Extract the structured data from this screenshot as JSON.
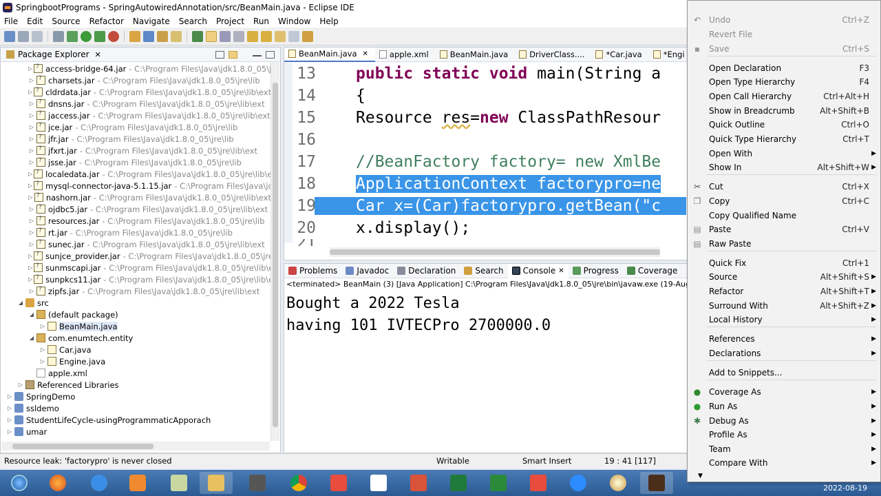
{
  "window": {
    "title": "SpringbootPrograms - SpringAutowiredAnnotation/src/BeanMain.java - Eclipse IDE"
  },
  "menubar": [
    "File",
    "Edit",
    "Source",
    "Refactor",
    "Navigate",
    "Search",
    "Project",
    "Run",
    "Window",
    "Help"
  ],
  "package_explorer": {
    "title": "Package Explorer",
    "close": "✕",
    "rows": [
      {
        "name": "access-bridge-64.jar",
        "path": "- C:\\Program Files\\Java\\jdk1.8.0_05\\jre\\lib\\e"
      },
      {
        "name": "charsets.jar",
        "path": "- C:\\Program Files\\Java\\jdk1.8.0_05\\jre\\lib"
      },
      {
        "name": "cldrdata.jar",
        "path": "- C:\\Program Files\\Java\\jdk1.8.0_05\\jre\\lib\\ext"
      },
      {
        "name": "dnsns.jar",
        "path": "- C:\\Program Files\\Java\\jdk1.8.0_05\\jre\\lib\\ext"
      },
      {
        "name": "jaccess.jar",
        "path": "- C:\\Program Files\\Java\\jdk1.8.0_05\\jre\\lib\\ext"
      },
      {
        "name": "jce.jar",
        "path": "- C:\\Program Files\\Java\\jdk1.8.0_05\\jre\\lib"
      },
      {
        "name": "jfr.jar",
        "path": "- C:\\Program Files\\Java\\jdk1.8.0_05\\jre\\lib"
      },
      {
        "name": "jfxrt.jar",
        "path": "- C:\\Program Files\\Java\\jdk1.8.0_05\\jre\\lib\\ext"
      },
      {
        "name": "jsse.jar",
        "path": "- C:\\Program Files\\Java\\jdk1.8.0_05\\jre\\lib"
      },
      {
        "name": "localedata.jar",
        "path": "- C:\\Program Files\\Java\\jdk1.8.0_05\\jre\\lib\\ext"
      },
      {
        "name": "mysql-connector-java-5.1.15.jar",
        "path": "- C:\\Program Files\\Java\\jdk1.8.0"
      },
      {
        "name": "nashorn.jar",
        "path": "- C:\\Program Files\\Java\\jdk1.8.0_05\\jre\\lib\\ext"
      },
      {
        "name": "ojdbc5.jar",
        "path": "- C:\\Program Files\\Java\\jdk1.8.0_05\\jre\\lib\\ext"
      },
      {
        "name": "resources.jar",
        "path": "- C:\\Program Files\\Java\\jdk1.8.0_05\\jre\\lib"
      },
      {
        "name": "rt.jar",
        "path": "- C:\\Program Files\\Java\\jdk1.8.0_05\\jre\\lib"
      },
      {
        "name": "sunec.jar",
        "path": "- C:\\Program Files\\Java\\jdk1.8.0_05\\jre\\lib\\ext"
      },
      {
        "name": "sunjce_provider.jar",
        "path": "- C:\\Program Files\\Java\\jdk1.8.0_05\\jre\\lib\\ext"
      },
      {
        "name": "sunmscapi.jar",
        "path": "- C:\\Program Files\\Java\\jdk1.8.0_05\\jre\\lib\\ext"
      },
      {
        "name": "sunpkcs11.jar",
        "path": "- C:\\Program Files\\Java\\jdk1.8.0_05\\jre\\lib\\ext"
      },
      {
        "name": "zipfs.jar",
        "path": "- C:\\Program Files\\Java\\jdk1.8.0_05\\jre\\lib\\ext"
      }
    ],
    "src": "src",
    "default_package": "(default package)",
    "beanmain": "BeanMain.java",
    "entity_package": "com.enumtech.entity",
    "car": "Car.java",
    "engine": "Engine.java",
    "applexml": "apple.xml",
    "reflibs": "Referenced Libraries",
    "projects": [
      "SpringDemo",
      "ssldemo",
      "StudentLifeCycle-usingProgrammaticApporach",
      "umar"
    ]
  },
  "editor": {
    "tabs": [
      "BeanMain.java",
      "apple.xml",
      "BeanMain.java",
      "DriverClass....",
      "*Car.java",
      "*Engi"
    ],
    "lines": [
      {
        "n": "13",
        "text": "public static void main(String a"
      },
      {
        "n": "14",
        "text": "{"
      },
      {
        "n": "15",
        "text": "Resource res=new ClassPathResour"
      },
      {
        "n": "16",
        "text": ""
      },
      {
        "n": "17",
        "text": "//BeanFactory factory= new XmlBe"
      },
      {
        "n": "18",
        "text": "ApplicationContext factorypro=ne"
      },
      {
        "n": "19",
        "text": "Car x=(Car)factorypro.getBean(\"c"
      },
      {
        "n": "20",
        "text": "x.display();"
      },
      {
        "n": "21",
        "text": ""
      }
    ]
  },
  "console": {
    "tabs": [
      "Problems",
      "Javadoc",
      "Declaration",
      "Search",
      "Console",
      "Progress",
      "Coverage"
    ],
    "info": "<terminated> BeanMain (3) [Java Application] C:\\Program Files\\Java\\jdk1.8.0_05\\jre\\bin\\javaw.exe  (19-Aug-2022, 10:5",
    "output": [
      "Bought a 2022 Tesla",
      "having 101 IVTECPro 2700000.0"
    ]
  },
  "status": {
    "message": "Resource leak: 'factorypro' is never closed",
    "writable": "Writable",
    "insert": "Smart Insert",
    "position": "19 : 41 [117]"
  },
  "taskbar": {
    "date": "2022-08-19"
  },
  "context_menu": [
    {
      "label": "Undo",
      "acc": "Ctrl+Z",
      "disabled": true
    },
    {
      "label": "Revert File",
      "acc": "",
      "disabled": true
    },
    {
      "label": "Save",
      "acc": "Ctrl+S",
      "disabled": true
    },
    {
      "label": "Open Declaration",
      "acc": "F3"
    },
    {
      "label": "Open Type Hierarchy",
      "acc": "F4"
    },
    {
      "label": "Open Call Hierarchy",
      "acc": "Ctrl+Alt+H"
    },
    {
      "label": "Show in Breadcrumb",
      "acc": "Alt+Shift+B"
    },
    {
      "label": "Quick Outline",
      "acc": "Ctrl+O"
    },
    {
      "label": "Quick Type Hierarchy",
      "acc": "Ctrl+T"
    },
    {
      "label": "Open With",
      "acc": ""
    },
    {
      "label": "Show In",
      "acc": "Alt+Shift+W"
    },
    {
      "label": "Cut",
      "acc": "Ctrl+X"
    },
    {
      "label": "Copy",
      "acc": "Ctrl+C"
    },
    {
      "label": "Copy Qualified Name",
      "acc": ""
    },
    {
      "label": "Paste",
      "acc": "Ctrl+V"
    },
    {
      "label": "Raw Paste",
      "acc": ""
    },
    {
      "label": "Quick Fix",
      "acc": "Ctrl+1"
    },
    {
      "label": "Source",
      "acc": "Alt+Shift+S"
    },
    {
      "label": "Refactor",
      "acc": "Alt+Shift+T"
    },
    {
      "label": "Surround With",
      "acc": "Alt+Shift+Z"
    },
    {
      "label": "Local History",
      "acc": ""
    },
    {
      "label": "References",
      "acc": ""
    },
    {
      "label": "Declarations",
      "acc": ""
    },
    {
      "label": "Add to Snippets...",
      "acc": ""
    },
    {
      "label": "Coverage As",
      "acc": ""
    },
    {
      "label": "Run As",
      "acc": ""
    },
    {
      "label": "Debug As",
      "acc": ""
    },
    {
      "label": "Profile As",
      "acc": ""
    },
    {
      "label": "Team",
      "acc": ""
    },
    {
      "label": "Compare With",
      "acc": ""
    }
  ]
}
